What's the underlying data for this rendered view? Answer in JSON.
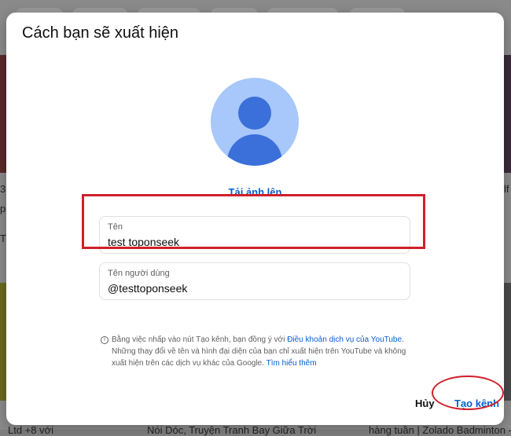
{
  "dialog": {
    "title": "Cách bạn sẽ xuất hiện",
    "upload_label": "Tải ảnh lên",
    "name_field": {
      "label": "Tên",
      "value": "test toponseek"
    },
    "handle_field": {
      "label": "Tên người dùng",
      "value": "@testtoponseek"
    },
    "disclaimer": {
      "part1": "Bằng việc nhấp vào nút Tạo kênh, bạn đồng ý với ",
      "tos_link": "Điều khoản dịch vụ của YouTube",
      "part2": ". Những thay đổi về tên và hình đại diện của bạn chỉ xuất hiện trên YouTube và không xuất hiện trên các dịch vụ khác của Google. ",
      "learn_more": "Tìm hiểu thêm"
    },
    "cancel_label": "Hủy",
    "create_label": "Tạo kênh"
  },
  "background": {
    "left_snippets": [
      "3",
      "p",
      "T"
    ],
    "right_snippet": "lf",
    "bottom_left": "Ltd +8 với",
    "bottom_mid": "Nói Dóc, Truyện Tranh Bay Giữa Trời",
    "bottom_right": "hàng tuần | Zolado Badminton - Z"
  },
  "colors": {
    "accent": "#065fd4",
    "highlight": "#d0202a",
    "avatar_bg": "#a8c7fa",
    "avatar_fg": "#3b6fd9"
  }
}
